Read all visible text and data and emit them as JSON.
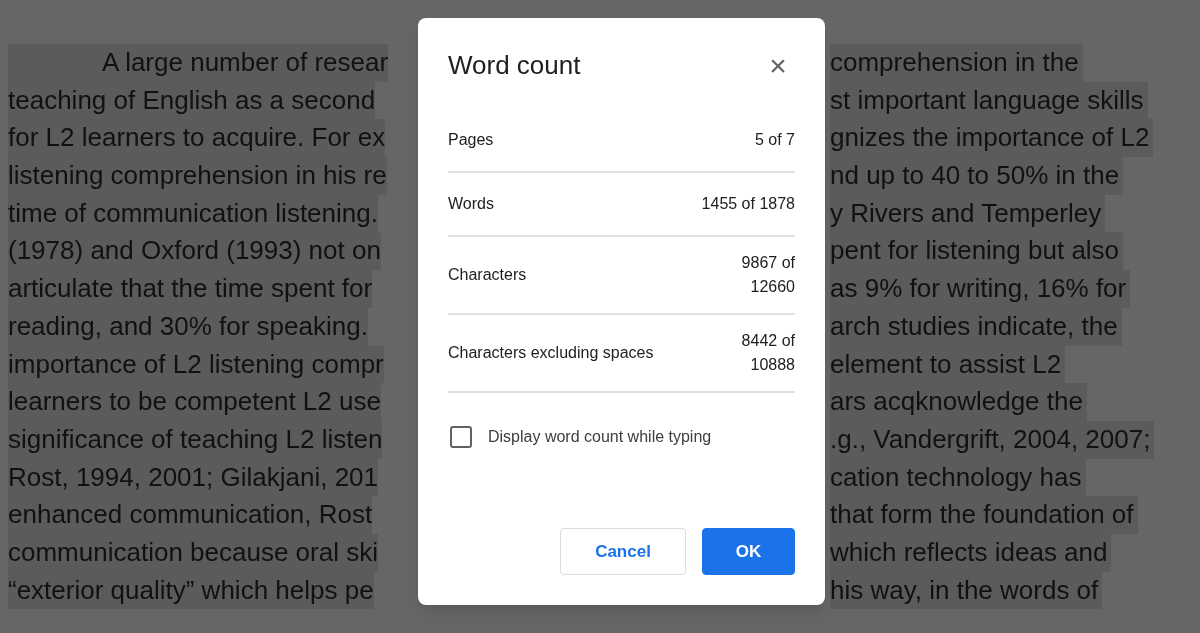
{
  "document": {
    "lines": [
      {
        "left": "A large number of resear",
        "right": "comprehension in the",
        "indent": true
      },
      {
        "left": "teaching of English as a second",
        "right": "st important language skills",
        "indent": false
      },
      {
        "left": "for L2 learners to acquire. For ex",
        "right": "gnizes the importance of L2",
        "indent": false
      },
      {
        "left": "listening comprehension in his re",
        "right": "nd up to 40 to 50% in the",
        "indent": false
      },
      {
        "left": "time of communication listening.",
        "right": "y Rivers and Temperley",
        "indent": false
      },
      {
        "left": "(1978) and Oxford (1993) not on",
        "right": "pent for listening but also",
        "indent": false
      },
      {
        "left": "articulate that the time spent for",
        "right": "as 9% for writing, 16% for",
        "indent": false
      },
      {
        "left": "reading, and 30% for speaking.",
        "right": "arch studies indicate, the",
        "indent": false
      },
      {
        "left": "importance of L2 listening compr",
        "right": "element to assist L2",
        "indent": false
      },
      {
        "left": "learners to be competent L2 use",
        "right": "ars acqknowledge the",
        "indent": false
      },
      {
        "left": "significance of teaching L2 listen",
        "right": ".g., Vandergrift, 2004, 2007;",
        "indent": false
      },
      {
        "left": "Rost, 1994, 2001; Gilakjani, 201",
        "right": "cation technology has",
        "indent": false
      },
      {
        "left": "enhanced communication, Rost",
        "right": "that form the foundation of",
        "indent": false
      },
      {
        "left": "communication because oral ski",
        "right": "which reflects ideas and",
        "indent": false
      },
      {
        "left": "“exterior quality” which helps pe",
        "right": "his way, in the words of",
        "indent": false
      }
    ]
  },
  "dialog": {
    "title": "Word count",
    "close": "×",
    "stats": [
      {
        "label": "Pages",
        "value_lines": [
          "5 of 7"
        ]
      },
      {
        "label": "Words",
        "value_lines": [
          "1455 of 1878"
        ]
      },
      {
        "label": "Characters",
        "value_lines": [
          "9867 of",
          "12660"
        ]
      },
      {
        "label": "Characters excluding spaces",
        "value_lines": [
          "8442 of",
          "10888"
        ]
      }
    ],
    "checkbox": {
      "label": "Display word count while typing",
      "checked": false
    },
    "buttons": [
      {
        "label": "Cancel",
        "kind": "secondary"
      },
      {
        "label": "OK",
        "kind": "primary"
      }
    ]
  }
}
